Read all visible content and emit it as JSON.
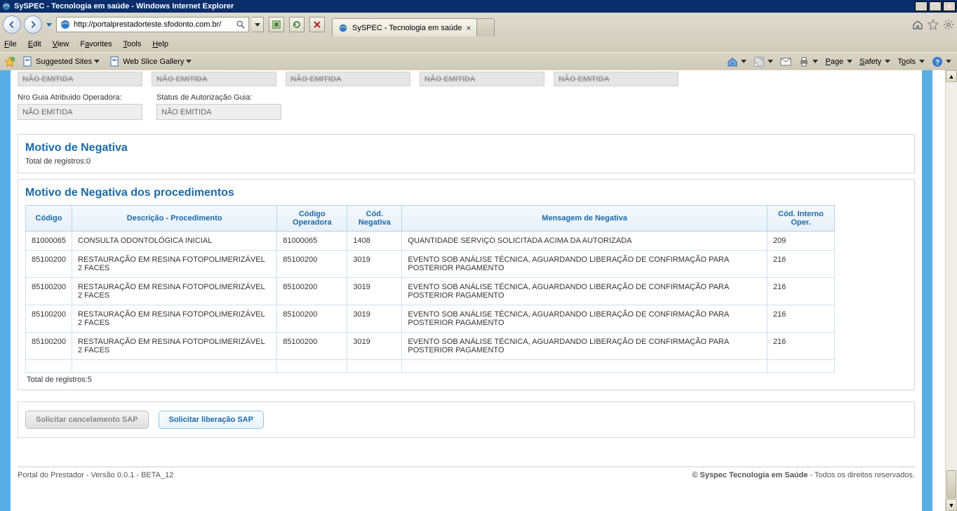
{
  "window": {
    "title": "SySPEC - Tecnologia em saúde - Windows Internet Explorer"
  },
  "address": {
    "url": "http://portalprestadorteste.sfodonto.com.br/"
  },
  "tab": {
    "label": "SySPEC - Tecnologia em saúde"
  },
  "menubar": {
    "file": "File",
    "edit": "Edit",
    "view": "View",
    "favorites": "Favorites",
    "tools": "Tools",
    "help": "Help"
  },
  "favbar": {
    "suggested": "Suggested Sites",
    "webslice": "Web Slice Gallery",
    "page": "Page",
    "safety": "Safety",
    "tools": "Tools"
  },
  "top_boxes": [
    "NÃO EMITIDA",
    "NÃO EMITIDA",
    "NÃO EMITIDA",
    "NÃO EMITIDA",
    "NÃO EMITIDA"
  ],
  "form": {
    "nro_label": "Nro Guia Atribuido Operadora:",
    "nro_value": "NÃO EMITIDA",
    "status_label": "Status de Autorização Guia:",
    "status_value": "NÃO EMITIDA"
  },
  "motivo_panel": {
    "title": "Motivo de Negativa",
    "total": "Total de registros:0"
  },
  "proc_panel": {
    "title": "Motivo de Negativa dos procedimentos",
    "columns": [
      "Código",
      "Descrição - Procedimento",
      "Código Operadora",
      "Cód. Negativa",
      "Mensagem de Negativa",
      "Cód. Interno Oper."
    ],
    "rows": [
      {
        "codigo": "81000065",
        "desc": "CONSULTA ODONTOLÓGICA INICIAL",
        "cod_op": "81000065",
        "cod_neg": "1408",
        "msg": "QUANTIDADE SERVIÇO SOLICITADA ACIMA DA AUTORIZADA",
        "cod_int": "209"
      },
      {
        "codigo": "85100200",
        "desc": "RESTAURAÇÃO EM RESINA FOTOPOLIMERIZÁVEL 2 FACES",
        "cod_op": "85100200",
        "cod_neg": "3019",
        "msg": "EVENTO SOB ANÁLISE TÉCNICA, AGUARDANDO LIBERAÇÃO DE CONFIRMAÇÃO PARA POSTERIOR PAGAMENTO",
        "cod_int": "216"
      },
      {
        "codigo": "85100200",
        "desc": "RESTAURAÇÃO EM RESINA FOTOPOLIMERIZÁVEL 2 FACES",
        "cod_op": "85100200",
        "cod_neg": "3019",
        "msg": "EVENTO SOB ANÁLISE TÉCNICA, AGUARDANDO LIBERAÇÃO DE CONFIRMAÇÃO PARA POSTERIOR PAGAMENTO",
        "cod_int": "216"
      },
      {
        "codigo": "85100200",
        "desc": "RESTAURAÇÃO EM RESINA FOTOPOLIMERIZÁVEL 2 FACES",
        "cod_op": "85100200",
        "cod_neg": "3019",
        "msg": "EVENTO SOB ANÁLISE TÉCNICA, AGUARDANDO LIBERAÇÃO DE CONFIRMAÇÃO PARA POSTERIOR PAGAMENTO",
        "cod_int": "216"
      },
      {
        "codigo": "85100200",
        "desc": "RESTAURAÇÃO EM RESINA FOTOPOLIMERIZÁVEL 2 FACES",
        "cod_op": "85100200",
        "cod_neg": "3019",
        "msg": "EVENTO SOB ANÁLISE TÉCNICA, AGUARDANDO LIBERAÇÃO DE CONFIRMAÇÃO PARA POSTERIOR PAGAMENTO",
        "cod_int": "216"
      }
    ],
    "total": "Total de registros:5"
  },
  "actions": {
    "cancel": "Solicitar cancelamento SAP",
    "release": "Solicitar liberação SAP"
  },
  "footer": {
    "left": "Portal do Prestador - Versão 0.0.1 - BETA_12",
    "right_bold": "© Syspec Tecnologia em Saúde",
    "right_rest": " - Todos os direitos reservados."
  }
}
